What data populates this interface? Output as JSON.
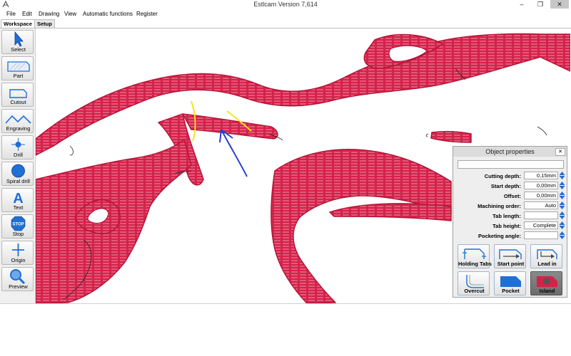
{
  "window": {
    "title": "Estlcam Version 7,614",
    "minimize": "–",
    "maximize": "❐",
    "close": "✕"
  },
  "menu": [
    "File",
    "Edit",
    "Drawing",
    "View",
    "Automatic functions",
    "Register"
  ],
  "tabs": [
    {
      "label": "Workspace",
      "active": true
    },
    {
      "label": "Setup",
      "active": false
    }
  ],
  "tools": [
    {
      "id": "select",
      "label": "Select",
      "icon": "cursor-arrow-icon"
    },
    {
      "id": "part",
      "label": "Part",
      "icon": "part-outline-icon"
    },
    {
      "id": "cutout",
      "label": "Cutout",
      "icon": "cutout-shape-icon"
    },
    {
      "id": "engraving",
      "label": "Engraving",
      "icon": "zigzag-line-icon"
    },
    {
      "id": "drill",
      "label": "Drill",
      "icon": "crosshair-icon"
    },
    {
      "id": "spiral_drill",
      "label": "Spiral drill",
      "icon": "filled-circle-icon"
    },
    {
      "id": "text",
      "label": "Text",
      "icon": "letter-a-icon"
    },
    {
      "id": "stop",
      "label": "Stop",
      "icon": "stop-sign-icon"
    },
    {
      "id": "origin",
      "label": "Origin",
      "icon": "plus-origin-icon"
    },
    {
      "id": "preview",
      "label": "Preview",
      "icon": "magnifier-icon"
    }
  ],
  "stop_sign_text": "STOP",
  "text_tool_glyph": "A",
  "object_properties": {
    "title": "Object properties",
    "close": "✕",
    "name_value": "",
    "fields": [
      {
        "label": "Cutting depth:",
        "value": "0,15mm"
      },
      {
        "label": "Start depth:",
        "value": "0,00mm"
      },
      {
        "label": "Offset:",
        "value": "0,00mm"
      },
      {
        "label": "Machining order:",
        "value": "Auto"
      },
      {
        "label": "Tab length:",
        "value": ""
      },
      {
        "label": "Tab height:",
        "value": "Complete"
      },
      {
        "label": "Pocketing angle:",
        "value": ""
      }
    ],
    "buttons": [
      {
        "label": "Holding Tabs",
        "icon": "holding-tabs-icon",
        "selected": false
      },
      {
        "label": "Start point",
        "icon": "start-point-icon",
        "selected": false
      },
      {
        "label": "Lead in",
        "icon": "lead-in-icon",
        "selected": false
      },
      {
        "label": "Overcut",
        "icon": "overcut-icon",
        "selected": false
      },
      {
        "label": "Pocket",
        "icon": "pocket-icon",
        "selected": false
      },
      {
        "label": "Island",
        "icon": "island-icon",
        "selected": true
      }
    ]
  },
  "colors": {
    "part_fill": "#d5224a",
    "hatch": "#f2a0b4",
    "annotation_yellow": "#f0e81e",
    "annotation_blue": "#2a3fd0",
    "toolbar_blue": "#1f6fd6"
  }
}
